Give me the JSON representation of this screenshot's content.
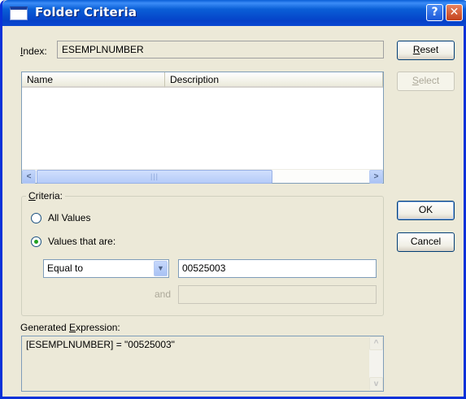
{
  "window": {
    "title": "Folder Criteria",
    "help_glyph": "?",
    "close_glyph": "✕"
  },
  "index": {
    "label_prefix": "",
    "label_accel": "I",
    "label_rest": "ndex:",
    "value": "ESEMPLNUMBER"
  },
  "list": {
    "columns": [
      "Name",
      "Description"
    ],
    "rows": [],
    "scroll_left": "<",
    "scroll_right": ">",
    "thumb_grip": "|||"
  },
  "criteria": {
    "legend_accel": "C",
    "legend_rest": "riteria:",
    "options": [
      {
        "label": "All Values",
        "selected": false
      },
      {
        "label": "Values that are:",
        "selected": true
      }
    ],
    "operator": "Equal to",
    "value": "00525003",
    "and_label": "and",
    "value2": ""
  },
  "generated": {
    "label_prefix": "Generated ",
    "label_accel": "E",
    "label_rest": "xpression:",
    "value": "[ESEMPLNUMBER] = \"00525003\"",
    "scroll_up": "^",
    "scroll_down": "v"
  },
  "buttons": {
    "reset_accel": "R",
    "reset_rest": "eset",
    "select_accel": "S",
    "select_rest": "elect",
    "ok": "OK",
    "cancel": "Cancel"
  }
}
